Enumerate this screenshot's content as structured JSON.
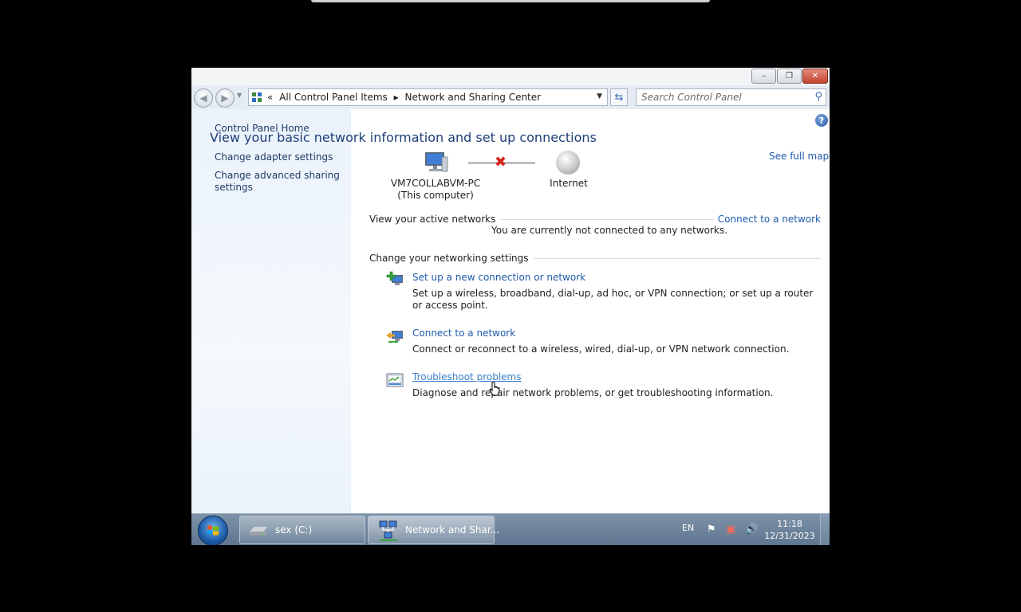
{
  "window": {
    "caption_buttons": {
      "minimize": "–",
      "maximize": "❐",
      "close": "✕"
    }
  },
  "navbar": {
    "back_glyph": "◀",
    "forward_glyph": "▶",
    "breadcrumb_prefix": "«",
    "breadcrumbs": [
      "All Control Panel Items",
      "Network and Sharing Center"
    ],
    "breadcrumb_separator": "▸",
    "search_placeholder": "Search Control Panel"
  },
  "sidebar": {
    "items": [
      {
        "label": "Control Panel Home"
      },
      {
        "label": "Change adapter settings"
      },
      {
        "label": "Change advanced sharing settings"
      }
    ]
  },
  "main": {
    "title": "View your basic network information and set up connections",
    "see_full_map": "See full map",
    "map": {
      "computer_name": "VM7COLLABVM-PC",
      "computer_sub": "(This computer)",
      "internet_label": "Internet",
      "status": "disconnected"
    },
    "active_networks": {
      "heading": "View your active networks",
      "connect_link": "Connect to a network",
      "status_text": "You are currently not connected to any networks."
    },
    "settings_heading": "Change your networking settings",
    "tasks": [
      {
        "title": "Set up a new connection or network",
        "description": "Set up a wireless, broadband, dial-up, ad hoc, or VPN connection; or set up a router or access point.",
        "icon": "new-connection-icon"
      },
      {
        "title": "Connect to a network",
        "description": "Connect or reconnect to a wireless, wired, dial-up, or VPN network connection.",
        "icon": "connect-network-icon"
      },
      {
        "title": "Troubleshoot problems",
        "description": "Diagnose and repair network problems, or get troubleshooting information.",
        "icon": "troubleshoot-icon"
      }
    ]
  },
  "taskbar": {
    "buttons": [
      {
        "label": "sex (C:)",
        "icon": "drive-icon"
      },
      {
        "label": "Network and Shar...",
        "icon": "network-icon"
      }
    ],
    "language": "EN",
    "time": "11:18",
    "date": "12/31/2023"
  },
  "colors": {
    "link": "#1e5aab",
    "title": "#1e3f7a",
    "sidebar_bg": "#eaf2fb",
    "taskbar": "#6a819a",
    "error_x": "#d8231a"
  }
}
